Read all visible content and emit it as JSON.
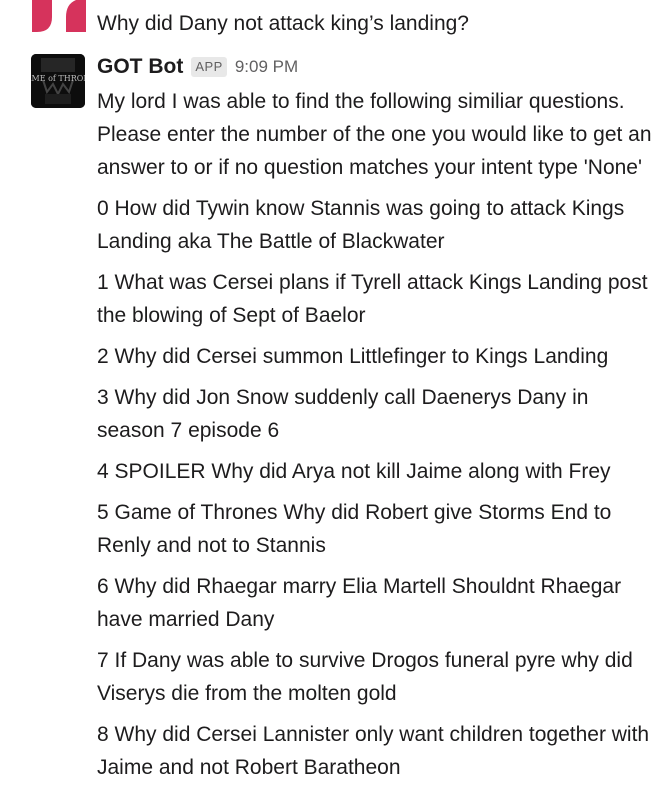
{
  "user_message": {
    "text": "Why did Dany not attack king’s landing?",
    "avatar_color": "#d6335c"
  },
  "bot_message": {
    "sender": "GOT Bot",
    "badge": "APP",
    "time": "9:09 PM",
    "avatar_text": "AME of THRON",
    "intro": "My lord I was able to find the following similiar questions. Please enter the number of the one you would like to get an answer to or if no question matches your intent type 'None'",
    "questions": [
      "0 How did Tywin know Stannis was going to attack Kings Landing aka The Battle of Blackwater",
      "1 What was Cersei plans if Tyrell attack Kings Landing post the blowing of Sept of Baelor",
      "2 Why did Cersei summon Littlefinger to Kings Landing",
      "3 Why did Jon Snow suddenly call Daenerys Dany in season 7 episode 6",
      "4 SPOILER Why did Arya not kill Jaime along with Frey",
      "5 Game of Thrones Why did Robert give Storms End to Renly and not to Stannis",
      "6 Why did Rhaegar marry Elia Martell Shouldnt Rhaegar have married Dany",
      "7 If Dany was able to survive Drogos funeral pyre why did Viserys die from the molten gold",
      "8 Why did Cersei Lannister only want children together with Jaime and not Robert Baratheon"
    ]
  }
}
